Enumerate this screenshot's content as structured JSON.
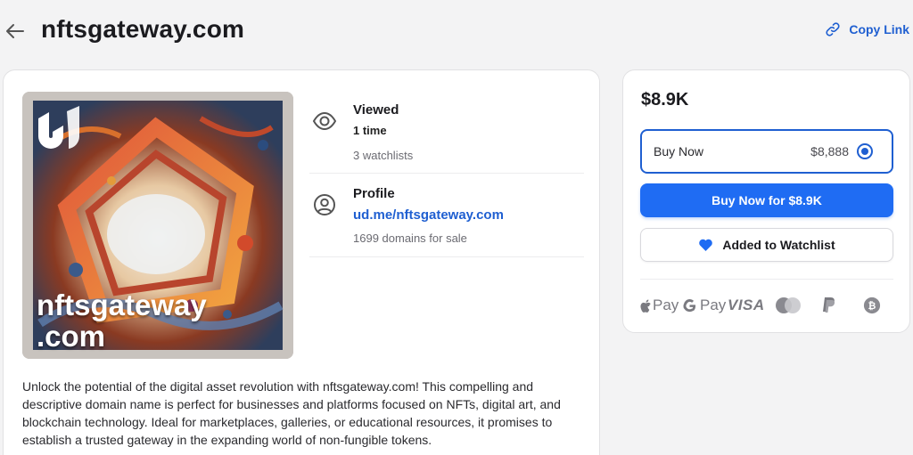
{
  "header": {
    "domain": "nftsgateway.com",
    "copy_link_label": "Copy Link"
  },
  "nft_card": {
    "name_line1": "nftsgateway",
    "name_line2": ".com"
  },
  "stats": {
    "viewed_title": "Viewed",
    "viewed_count": "1 time",
    "watchlists": "3 watchlists",
    "profile_title": "Profile",
    "profile_link": "ud.me/nftsgateway.com",
    "domains_for_sale": "1699 domains for sale"
  },
  "description": "Unlock the potential of the digital asset revolution with nftsgateway.com! This compelling and descriptive domain name is perfect for businesses and platforms focused on NFTs, digital art, and blockchain technology. Ideal for marketplaces, galleries, or educational resources, it promises to establish a trusted gateway in the expanding world of non-fungible tokens.",
  "purchase": {
    "price": "$8.9K",
    "option_label": "Buy Now",
    "option_price": "$8,888",
    "buy_button": "Buy Now for $8.9K",
    "watchlist_button": "Added to Watchlist"
  },
  "payments": {
    "apple_pay": "Pay",
    "google_pay": "Pay",
    "visa": "VISA",
    "methods": [
      "apple-pay",
      "google-pay",
      "visa",
      "mastercard",
      "paypal",
      "bitcoin"
    ]
  },
  "colors": {
    "accent": "#1f6cf3",
    "link": "#1f5fd1",
    "background": "#f3f3f4"
  }
}
